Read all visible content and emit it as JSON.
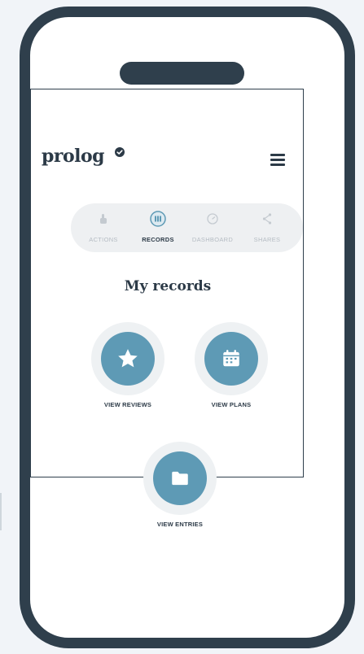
{
  "app": {
    "logo_text": "prolog",
    "menu_icon": "hamburger-menu-icon"
  },
  "tabs": [
    {
      "label": "ACTIONS",
      "icon": "hand-icon",
      "active": false
    },
    {
      "label": "RECORDS",
      "icon": "records-icon",
      "active": true
    },
    {
      "label": "DASHBOARD",
      "icon": "dashboard-icon",
      "active": false
    },
    {
      "label": "SHARES",
      "icon": "share-icon",
      "active": false
    }
  ],
  "page": {
    "title": "My records"
  },
  "records": [
    {
      "label": "VIEW REVIEWS",
      "icon": "star-icon"
    },
    {
      "label": "VIEW PLANS",
      "icon": "calendar-icon"
    },
    {
      "label": "VIEW ENTRIES",
      "icon": "folder-icon"
    }
  ],
  "colors": {
    "frame": "#2f3f4c",
    "accent": "#5e9ab5",
    "text": "#2c3a47",
    "muted": "#b5bcc3",
    "tab_bg": "#eef0f2",
    "background": "#f1f4f8"
  }
}
